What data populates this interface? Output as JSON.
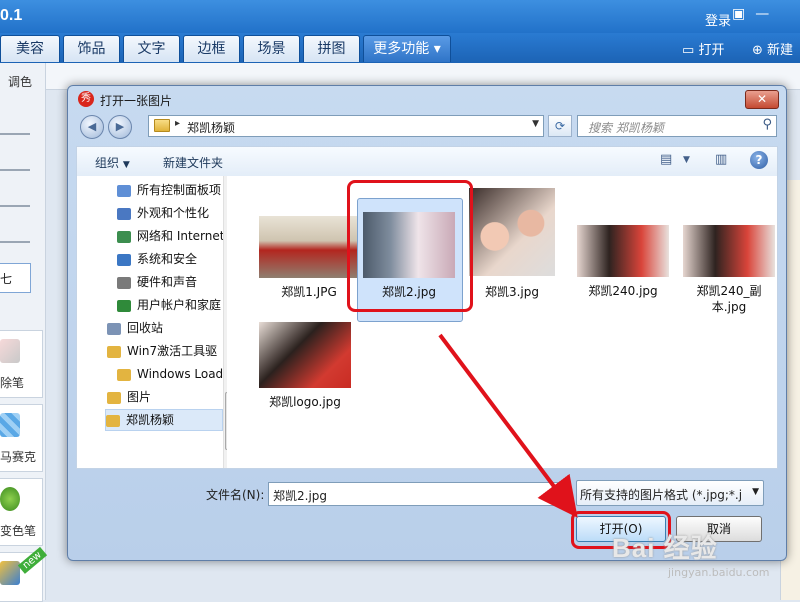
{
  "app": {
    "title": "0.1",
    "login_label": "登录",
    "tabs": [
      "美容",
      "饰品",
      "文字",
      "边框",
      "场景",
      "拼图",
      "更多功能"
    ],
    "more_caret": "▾",
    "open_label": "打开",
    "new_label": "新建",
    "left_panel": {
      "adjust_label": "调色",
      "tools": [
        "除笔",
        "马赛克",
        "变色笔"
      ],
      "badge": "new",
      "partial_label": "七"
    }
  },
  "dialog": {
    "title": "打开一张图片",
    "app_icon_text": "秀",
    "close_glyph": "✕",
    "address": {
      "path": "郑凯杨颖",
      "separator": "▸"
    },
    "search": {
      "placeholder": "搜索 郑凯杨颖"
    },
    "command_bar": {
      "organize": "组织",
      "new_folder": "新建文件夹",
      "help": "?"
    },
    "tree": [
      {
        "label": "所有控制面板项",
        "color": "#5f8fd6",
        "indent": 1
      },
      {
        "label": "外观和个性化",
        "color": "#4a78c2",
        "indent": 1
      },
      {
        "label": "网络和 Internet",
        "color": "#3c8e4f",
        "indent": 1
      },
      {
        "label": "系统和安全",
        "color": "#3b77c4",
        "indent": 1
      },
      {
        "label": "硬件和声音",
        "color": "#7a7a7a",
        "indent": 1
      },
      {
        "label": "用户帐户和家庭",
        "color": "#2f8a3a",
        "indent": 1
      },
      {
        "label": "回收站",
        "color": "#7c93b5",
        "indent": 0
      },
      {
        "label": "Win7激活工具驱",
        "color": "#e3b440",
        "indent": 0
      },
      {
        "label": "Windows Loader",
        "color": "#e3b440",
        "indent": 1
      },
      {
        "label": "图片",
        "color": "#e3b440",
        "indent": -1
      },
      {
        "label": "郑凯杨颖",
        "color": "#e3b440",
        "indent": -1,
        "selected": true
      }
    ],
    "files": [
      {
        "name": "郑凯1.JPG",
        "selected": false
      },
      {
        "name": "郑凯2.jpg",
        "selected": true
      },
      {
        "name": "郑凯3.jpg",
        "selected": false
      },
      {
        "name": "郑凯240.jpg",
        "selected": false
      },
      {
        "name": "郑凯240_副本.jpg",
        "selected": false
      },
      {
        "name": "郑凯logo.jpg",
        "selected": false
      }
    ],
    "filename_label": "文件名(N):",
    "filename_value": "郑凯2.jpg",
    "filter_value": "所有支持的图片格式 (*.jpg;*.jp",
    "open_button": "打开(O)",
    "cancel_button": "取消"
  },
  "colors": {
    "annotation_red": "#e0121b",
    "selection_blue": "#cfe3fb"
  },
  "watermark": {
    "text": "Bai 经验",
    "sub": "jingyan.baidu.com"
  }
}
